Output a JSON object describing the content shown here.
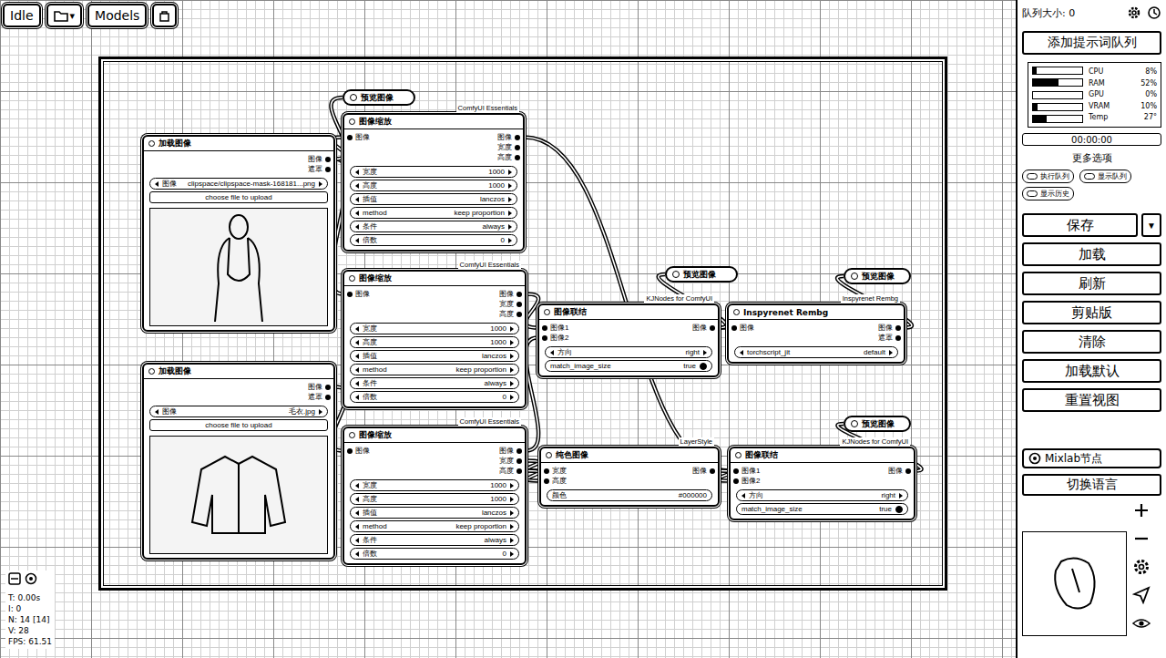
{
  "toolbar": {
    "status": "Idle",
    "dropdown": "▾",
    "models": "Models"
  },
  "nodes": [
    {
      "title": "加载图像",
      "source": "",
      "collapsed": false,
      "inputs": [],
      "outputs": [
        "图像",
        "遮罩"
      ],
      "widgets": [
        {
          "kind": "combo",
          "label": "图像",
          "value": "clipspace/clipspace-mask-168181...png"
        },
        {
          "kind": "button",
          "label": "choose file to upload"
        }
      ],
      "preview": true
    },
    {
      "title": "加载图像",
      "source": "",
      "collapsed": false,
      "inputs": [],
      "outputs": [
        "图像",
        "遮罩"
      ],
      "widgets": [
        {
          "kind": "combo",
          "label": "图像",
          "value": "毛衣.jpg"
        },
        {
          "kind": "button",
          "label": "choose file to upload"
        }
      ],
      "preview": true
    },
    {
      "title": "图像缩放",
      "source": "ComfyUI Essentials",
      "collapsed": false,
      "inputs": [
        "图像"
      ],
      "outputs": [
        "图像",
        "宽度",
        "高度"
      ],
      "widgets": [
        {
          "kind": "number",
          "label": "宽度",
          "value": "1000"
        },
        {
          "kind": "number",
          "label": "高度",
          "value": "1000"
        },
        {
          "kind": "combo",
          "label": "插值",
          "value": "lanczos"
        },
        {
          "kind": "combo",
          "label": "method",
          "value": "keep proportion"
        },
        {
          "kind": "combo",
          "label": "条件",
          "value": "always"
        },
        {
          "kind": "number",
          "label": "倍数",
          "value": "0"
        }
      ],
      "preview": false
    },
    {
      "title": "图像缩放",
      "source": "ComfyUI Essentials",
      "collapsed": false,
      "inputs": [
        "图像"
      ],
      "outputs": [
        "图像",
        "宽度",
        "高度"
      ],
      "widgets": [
        {
          "kind": "number",
          "label": "宽度",
          "value": "1000"
        },
        {
          "kind": "number",
          "label": "高度",
          "value": "1000"
        },
        {
          "kind": "combo",
          "label": "插值",
          "value": "lanczos"
        },
        {
          "kind": "combo",
          "label": "method",
          "value": "keep proportion"
        },
        {
          "kind": "combo",
          "label": "条件",
          "value": "always"
        },
        {
          "kind": "number",
          "label": "倍数",
          "value": "0"
        }
      ],
      "preview": false
    },
    {
      "title": "图像缩放",
      "source": "ComfyUI Essentials",
      "collapsed": false,
      "inputs": [
        "图像"
      ],
      "outputs": [
        "图像",
        "宽度",
        "高度"
      ],
      "widgets": [
        {
          "kind": "number",
          "label": "宽度",
          "value": "1000"
        },
        {
          "kind": "number",
          "label": "高度",
          "value": "1000"
        },
        {
          "kind": "combo",
          "label": "插值",
          "value": "lanczos"
        },
        {
          "kind": "combo",
          "label": "method",
          "value": "keep proportion"
        },
        {
          "kind": "combo",
          "label": "条件",
          "value": "always"
        },
        {
          "kind": "number",
          "label": "倍数",
          "value": "0"
        }
      ],
      "preview": false
    },
    {
      "title": "图像联结",
      "source": "KJNodes for ComfyUI",
      "collapsed": false,
      "inputs": [
        "图像1",
        "图像2"
      ],
      "outputs": [
        "图像"
      ],
      "widgets": [
        {
          "kind": "combo",
          "label": "方向",
          "value": "right"
        },
        {
          "kind": "toggle",
          "label": "match_image_size",
          "value": "true",
          "on": true
        }
      ],
      "preview": false
    },
    {
      "title": "Inspyrenet Rembg",
      "source": "Inspyrenet Rembg",
      "collapsed": false,
      "inputs": [
        "图像"
      ],
      "outputs": [
        "图像",
        "遮罩"
      ],
      "widgets": [
        {
          "kind": "combo",
          "label": "torchscript_jit",
          "value": "default"
        }
      ],
      "preview": false
    },
    {
      "title": "纯色图像",
      "source": "LayerStyle",
      "collapsed": false,
      "inputs": [
        "宽度",
        "高度"
      ],
      "outputs": [
        "图像"
      ],
      "widgets": [
        {
          "kind": "text",
          "label": "颜色",
          "value": "#000000"
        }
      ],
      "preview": false
    },
    {
      "title": "图像联结",
      "source": "KJNodes for ComfyUI",
      "collapsed": false,
      "inputs": [
        "图像1",
        "图像2"
      ],
      "outputs": [
        "图像"
      ],
      "widgets": [
        {
          "kind": "combo",
          "label": "方向",
          "value": "right"
        },
        {
          "kind": "toggle",
          "label": "match_image_size",
          "value": "true",
          "on": true
        }
      ],
      "preview": false
    },
    {
      "title": "预览图像",
      "source": "",
      "collapsed": true,
      "inputs": [
        "图像"
      ],
      "outputs": [],
      "widgets": [],
      "preview": false
    },
    {
      "title": "预览图像",
      "source": "",
      "collapsed": true,
      "inputs": [
        "图像"
      ],
      "outputs": [],
      "widgets": [],
      "preview": false
    },
    {
      "title": "预览图像",
      "source": "",
      "collapsed": true,
      "inputs": [
        "图像"
      ],
      "outputs": [],
      "widgets": [],
      "preview": false
    },
    {
      "title": "预览图像",
      "source": "",
      "collapsed": true,
      "inputs": [
        "图像"
      ],
      "outputs": [],
      "widgets": [],
      "preview": false
    }
  ],
  "sidebar": {
    "queue_size": "队列大小: 0",
    "add_prompt": "添加提示词队列",
    "monitor": [
      {
        "label": "CPU",
        "value": "8%",
        "level": 0.08
      },
      {
        "label": "RAM",
        "value": "52%",
        "level": 0.52
      },
      {
        "label": "GPU",
        "value": "0%",
        "level": 0.0
      },
      {
        "label": "VRAM",
        "value": "10%",
        "level": 0.1
      },
      {
        "label": "Temp",
        "value": "27°",
        "level": 0.27
      }
    ],
    "timer": "00:00:00",
    "progress": 0,
    "more_options": "更多选项",
    "toggles": [
      {
        "label": "执行队列",
        "on": false
      },
      {
        "label": "显示队列",
        "on": false
      },
      {
        "label": "显示历史",
        "on": false
      }
    ],
    "buttons": [
      {
        "label": "保存",
        "menu": "▼"
      },
      {
        "label": "加载"
      },
      {
        "label": "刷新"
      },
      {
        "label": "剪贴版"
      },
      {
        "label": "清除"
      },
      {
        "label": "加载默认"
      },
      {
        "label": "重置视图"
      }
    ],
    "mixlab": "Mixlab节点",
    "language": "切换语言"
  },
  "stats": [
    "T: 0.00s",
    "I: 0",
    "N: 14 [14]",
    "V: 28",
    "FPS: 61.51"
  ]
}
